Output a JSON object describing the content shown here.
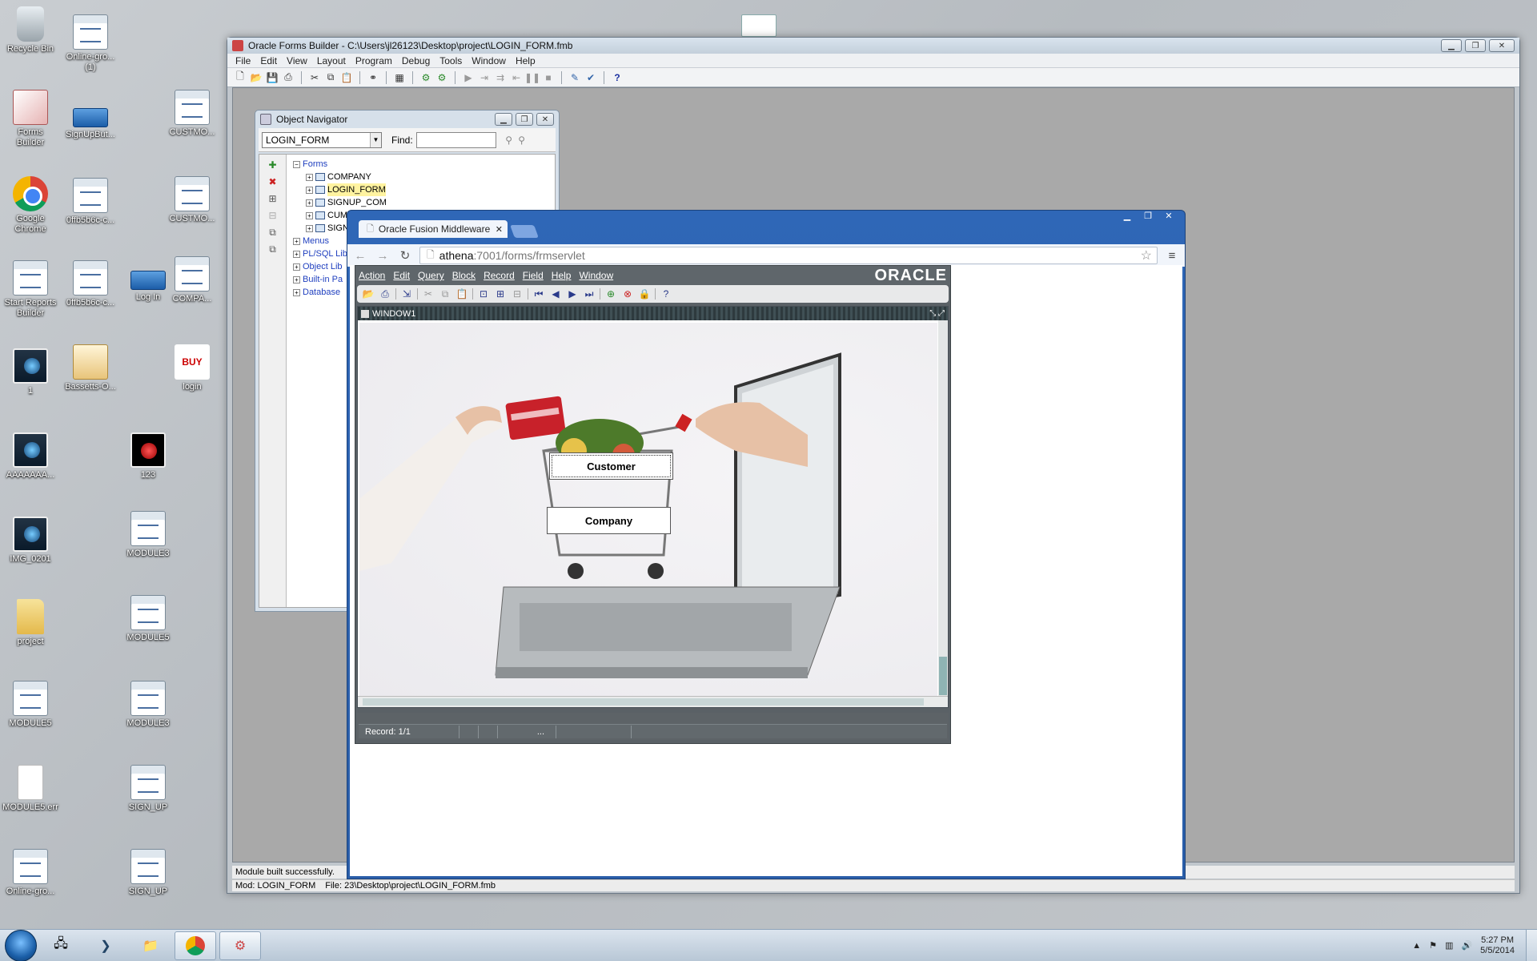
{
  "desktop": {
    "icons": [
      {
        "label": "Recycle Bin",
        "kind": "recycle"
      },
      {
        "label": "Online-gro...\n(1)",
        "kind": "app"
      },
      {
        "label": "Forms\nBuilder",
        "kind": "forms"
      },
      {
        "label": "SignUpBut...",
        "kind": "btn"
      },
      {
        "label": "CUSTMO...",
        "kind": "app"
      },
      {
        "label": "Google\nChrome",
        "kind": "chrome"
      },
      {
        "label": "0ffb5b6c-c...",
        "kind": "app"
      },
      {
        "label": "CUSTMO...",
        "kind": "app"
      },
      {
        "label": "Start Reports\nBuilder",
        "kind": "app"
      },
      {
        "label": "0ffb5b6c-c...",
        "kind": "app"
      },
      {
        "label": "Log In",
        "kind": "btn"
      },
      {
        "label": "COMPA...",
        "kind": "app"
      },
      {
        "label": "1",
        "kind": "photo"
      },
      {
        "label": "Bassetts-O...",
        "kind": "bag"
      },
      {
        "label": "login",
        "kind": "buy"
      },
      {
        "label": "AAAAAAA...",
        "kind": "photo"
      },
      {
        "label": "123",
        "kind": "red"
      },
      {
        "label": "IMG_0201",
        "kind": "photo"
      },
      {
        "label": "MODULE3",
        "kind": "app"
      },
      {
        "label": "project",
        "kind": "folder"
      },
      {
        "label": "MODULE5",
        "kind": "app"
      },
      {
        "label": "MODULE5",
        "kind": "app"
      },
      {
        "label": "MODULE3",
        "kind": "app"
      },
      {
        "label": "MODULE5.err",
        "kind": "doc"
      },
      {
        "label": "SIGN_UP",
        "kind": "app"
      },
      {
        "label": "Online-gro...",
        "kind": "app"
      },
      {
        "label": "SIGN_UP",
        "kind": "app"
      }
    ]
  },
  "forms_builder": {
    "title": "Oracle Forms Builder - C:\\Users\\jl26123\\Desktop\\project\\LOGIN_FORM.fmb",
    "menu": [
      "File",
      "Edit",
      "View",
      "Layout",
      "Program",
      "Debug",
      "Tools",
      "Window",
      "Help"
    ],
    "toolbar_icons": [
      "new-icon",
      "open-icon",
      "save-icon",
      "print-icon",
      "cut-icon",
      "copy-icon",
      "paste-icon",
      "connect-icon",
      "compile-icon",
      "run-form-icon",
      "debug-icon",
      "step-icon",
      "step-over-icon",
      "step-out-icon",
      "pause-icon",
      "stop-icon",
      "wizard-icon",
      "check-icon",
      "help-icon"
    ],
    "status_message": "Module built successfully.",
    "status_module": "Mod: LOGIN_FORM",
    "status_file": "File: 23\\Desktop\\project\\LOGIN_FORM.fmb"
  },
  "object_navigator": {
    "title": "Object Navigator",
    "combo_value": "LOGIN_FORM",
    "find_label": "Find:",
    "find_value": "",
    "tree": [
      {
        "label": "Forms",
        "level": 0,
        "expanded": true,
        "blue": true
      },
      {
        "label": "COMPANY",
        "level": 1,
        "highlight": false
      },
      {
        "label": "LOGIN_FORM",
        "level": 1,
        "highlight": true
      },
      {
        "label": "SIGNUP_COM",
        "level": 1,
        "highlight": false
      },
      {
        "label": "CUM",
        "level": 1,
        "highlight": false
      },
      {
        "label": "SIGN",
        "level": 1,
        "highlight": false
      },
      {
        "label": "Menus",
        "level": 0,
        "blue": true
      },
      {
        "label": "PL/SQL Lib",
        "level": 0,
        "blue": true
      },
      {
        "label": "Object Lib",
        "level": 0,
        "blue": true
      },
      {
        "label": "Built-in Pa",
        "level": 0,
        "blue": true
      },
      {
        "label": "Database",
        "level": 0,
        "blue": true
      }
    ]
  },
  "browser": {
    "tab_title": "Oracle Fusion Middleware",
    "url_host": "athena",
    "url_path": ":7001/forms/frmservlet"
  },
  "oracle_form": {
    "menu": [
      "Action",
      "Edit",
      "Query",
      "Block",
      "Record",
      "Field",
      "Help",
      "Window"
    ],
    "logo": "ORACLE",
    "window_title": "WINDOW1",
    "buttons": {
      "customer": "Customer",
      "company": "Company"
    },
    "record_status": "Record: 1/1",
    "status_ellipsis": "..."
  },
  "taskbar": {
    "time": "5:27 PM",
    "date": "5/5/2014"
  },
  "colors": {
    "accent_blue": "#2a5ea9",
    "oracle_gray": "#5a6166",
    "tree_blue": "#1f3fbf",
    "highlight": "#fff3a0"
  }
}
